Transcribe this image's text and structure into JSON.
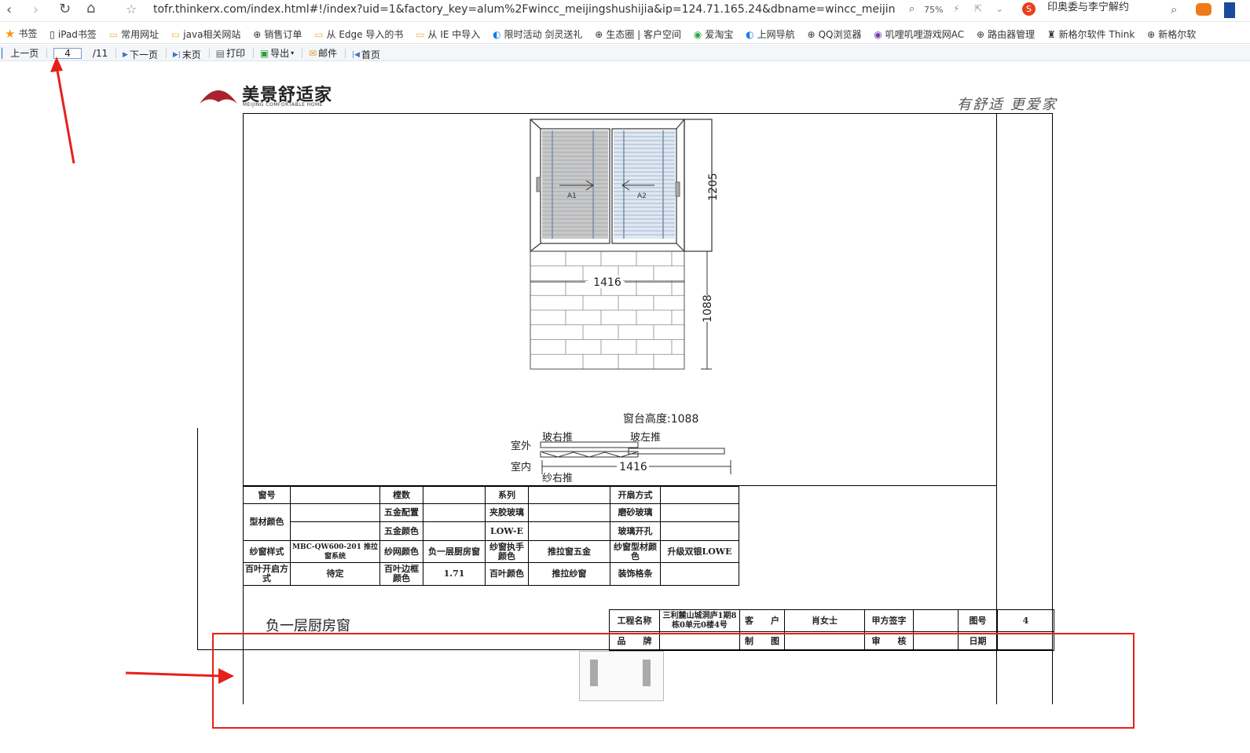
{
  "browser": {
    "url": "tofr.thinkerx.com/index.html#!/index?uid=1&factory_key=alum%2Fwincc_meijingshushijia&ip=124.71.165.24&dbname=wincc_meijingshushiji",
    "zoom": "75%",
    "news": "印奥委与李宁解约"
  },
  "bookmarks": [
    "书签",
    "iPad书签",
    "常用网址",
    "java相关网站",
    "销售订单",
    "从 Edge 导入的书",
    "从 IE 中导入",
    "限时活动 剑灵送礼",
    "生态圈 | 客户空间",
    "爱淘宝",
    "上网导航",
    "QQ浏览器",
    "叽哩叽哩游戏网AC",
    "路由器管理",
    "新格尔软件 Think",
    "新格尔软"
  ],
  "toolbar": {
    "prev": "上一页",
    "page": "4",
    "total": "/11",
    "next": "下一页",
    "last": "末页",
    "print": "打印",
    "export": "导出",
    "mail": "邮件",
    "first": "首页"
  },
  "doc": {
    "logo_cn": "美景舒适家",
    "logo_en": "MEIJING COMFORTABLE HOME",
    "slogan": "有舒适 更爱家",
    "dim_width": "1416",
    "dim_height": "1205",
    "dim_sill": "1088",
    "label_a1": "A1",
    "label_a2": "A2",
    "sill_label": "窗台高度:1088",
    "outside": "室外",
    "inside": "室内",
    "glass_right": "玻右推",
    "glass_left": "玻左推",
    "screen_right": "纱右推",
    "plan_width": "1416",
    "spec": [
      [
        "窗号",
        "",
        "樘数",
        "",
        "系列",
        "",
        "开扇方式",
        ""
      ],
      [
        "型材颜色",
        "",
        "五金配置",
        "",
        "夹胶玻璃",
        "",
        "磨砂玻璃",
        ""
      ],
      [
        "",
        "",
        "五金颜色",
        "",
        "LOW-E",
        "",
        "玻璃开孔",
        ""
      ],
      [
        "纱窗样式",
        "MBC-QW600-201 推拉窗系统",
        "纱网颜色",
        "负一层厨房窗",
        "纱窗执手颜色",
        "推拉窗五金",
        "纱窗型材颜色",
        "升级双银LOWE"
      ],
      [
        "百叶开启方式",
        "待定",
        "百叶边框颜色",
        "1.71",
        "百叶颜色",
        "推拉纱窗",
        "装饰格条",
        ""
      ]
    ],
    "window_name": "负一层厨房窗",
    "title_block": [
      [
        "工程名称",
        "三利麓山城洞庐1期8栋0单元0楼4号",
        "客　　户",
        "肖女士",
        "甲方签字",
        "",
        "图号",
        "4"
      ],
      [
        "品　　牌",
        "",
        "制　　图",
        "",
        "审　　核",
        "",
        "日期",
        ""
      ]
    ]
  }
}
